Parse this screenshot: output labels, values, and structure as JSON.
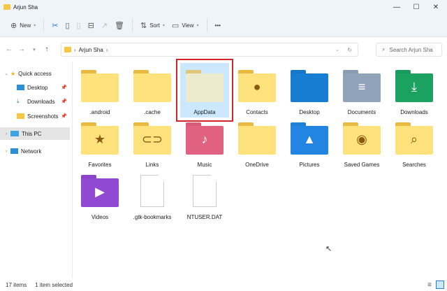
{
  "window": {
    "title": "Arjun Sha",
    "minimize": "—",
    "maximize": "☐",
    "close": "✕"
  },
  "toolbar": {
    "new": "New",
    "sort": "Sort",
    "view": "View",
    "more": "•••"
  },
  "address": {
    "crumb": "Arjun Sha",
    "search_placeholder": "Search Arjun Sha"
  },
  "sidebar": {
    "items": [
      {
        "label": "Quick access"
      },
      {
        "label": "Desktop"
      },
      {
        "label": "Downloads"
      },
      {
        "label": "Screenshots"
      },
      {
        "label": "This PC"
      },
      {
        "label": "Network"
      }
    ]
  },
  "files": [
    {
      "name": ".android",
      "type": "folder"
    },
    {
      "name": ".cache",
      "type": "folder"
    },
    {
      "name": "AppData",
      "type": "folder-hidden",
      "selected": true
    },
    {
      "name": "Contacts",
      "type": "contacts"
    },
    {
      "name": "Desktop",
      "type": "desktop"
    },
    {
      "name": "Documents",
      "type": "documents"
    },
    {
      "name": "Downloads",
      "type": "downloads"
    },
    {
      "name": "Favorites",
      "type": "favorites"
    },
    {
      "name": "Links",
      "type": "links"
    },
    {
      "name": "Music",
      "type": "music"
    },
    {
      "name": "OneDrive",
      "type": "folder"
    },
    {
      "name": "Pictures",
      "type": "pictures"
    },
    {
      "name": "Saved Games",
      "type": "games"
    },
    {
      "name": "Searches",
      "type": "searches"
    },
    {
      "name": "Videos",
      "type": "videos"
    },
    {
      "name": ".gtk-bookmarks",
      "type": "file"
    },
    {
      "name": "NTUSER.DAT",
      "type": "file"
    }
  ],
  "status": {
    "count": "17 items",
    "selected": "1 item selected"
  },
  "colors": {
    "selection_border": "#d0262c",
    "selection_fill": "#cce8ff",
    "folder": "#f8d775"
  }
}
